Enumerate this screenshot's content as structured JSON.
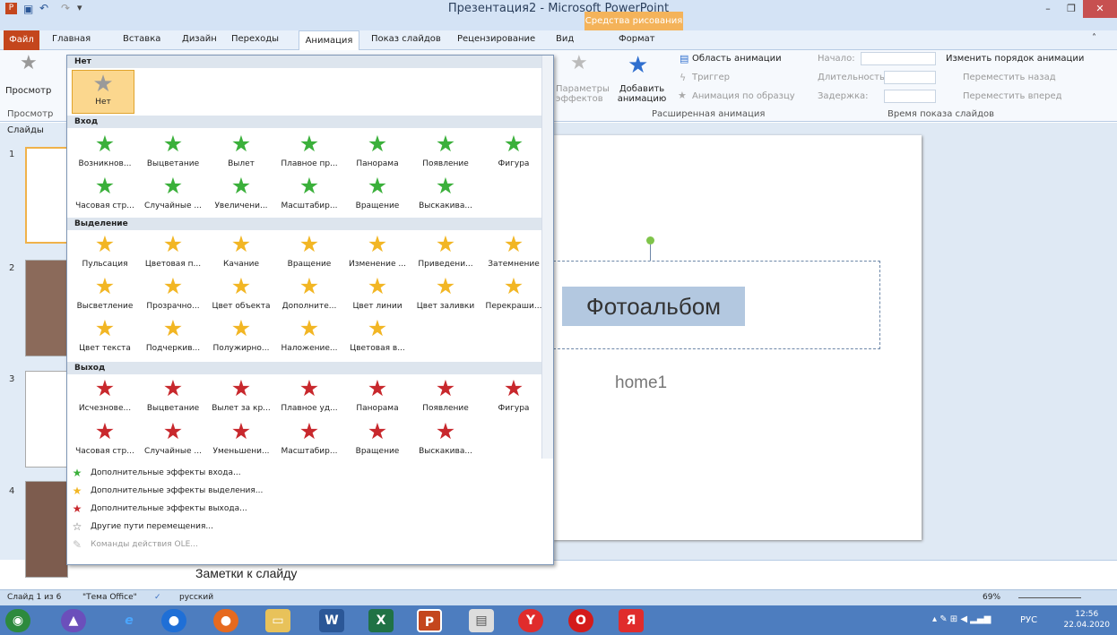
{
  "window": {
    "title": "Презентация2 - Microsoft PowerPoint",
    "contextual_tab_group": "Средства рисования",
    "controls": [
      "–",
      "❐",
      "✕"
    ]
  },
  "tabs": [
    {
      "label": "Файл"
    },
    {
      "label": "Главная"
    },
    {
      "label": "Вставка"
    },
    {
      "label": "Дизайн"
    },
    {
      "label": "Переходы"
    },
    {
      "label": "Анимация"
    },
    {
      "label": "Показ слайдов"
    },
    {
      "label": "Рецензирование"
    },
    {
      "label": "Вид"
    },
    {
      "label": "Формат"
    }
  ],
  "ribbon": {
    "preview": {
      "label": "Просмотр",
      "group": "Просмотр"
    },
    "effect_params": "Параметры эффектов",
    "add_animation": "Добавить анимацию",
    "animation_pane": "Область анимации",
    "trigger": "Триггер",
    "animation_painter": "Анимация по образцу",
    "advanced_group": "Расширенная анимация",
    "start_label": "Начало:",
    "duration_label": "Длительность:",
    "delay_label": "Задержка:",
    "reorder_title": "Изменить порядок анимации",
    "move_back": "Переместить назад",
    "move_forward": "Переместить вперед",
    "timing_group": "Время показа слайдов"
  },
  "slides_panel": {
    "tab": "Слайды",
    "numbers": [
      "1",
      "2",
      "3",
      "4"
    ]
  },
  "gallery": {
    "none": {
      "header": "Нет",
      "item": "Нет"
    },
    "entrance": {
      "header": "Вход",
      "items": [
        "Возникнов...",
        "Выцветание",
        "Вылет",
        "Плавное пр...",
        "Панорама",
        "Появление",
        "Фигура",
        "Часовая стр...",
        "Случайные ...",
        "Увеличени...",
        "Масштабир...",
        "Вращение",
        "Выскакива..."
      ]
    },
    "emphasis": {
      "header": "Выделение",
      "items": [
        "Пульсация",
        "Цветовая п...",
        "Качание",
        "Вращение",
        "Изменение ...",
        "Приведени...",
        "Затемнение",
        "Высветление",
        "Прозрачно...",
        "Цвет объекта",
        "Дополните...",
        "Цвет линии",
        "Цвет заливки",
        "Перекраши...",
        "Цвет текста",
        "Подчеркив...",
        "Полужирно...",
        "Наложение...",
        "Цветовая в..."
      ]
    },
    "exit": {
      "header": "Выход",
      "items": [
        "Исчезнове...",
        "Выцветание",
        "Вылет за кр...",
        "Плавное уд...",
        "Панорама",
        "Появление",
        "Фигура",
        "Часовая стр...",
        "Случайные ...",
        "Уменьшени...",
        "Масштабир...",
        "Вращение",
        "Выскакива..."
      ]
    },
    "more": [
      "Дополнительные эффекты входа...",
      "Дополнительные эффекты выделения...",
      "Дополнительные эффекты выхода...",
      "Другие пути перемещения...",
      "Команды действия OLE..."
    ]
  },
  "slide": {
    "title": "Фотоальбом",
    "subtitle": "home1"
  },
  "notes": {
    "placeholder": "Заметки к слайду"
  },
  "status": {
    "slide": "Слайд 1 из 6",
    "theme": "\"Тема Office\"",
    "language": "русский",
    "zoom": "69%"
  },
  "taskbar": {
    "lang": "РУС",
    "time": "12:56",
    "date": "22.04.2020"
  },
  "colors": {
    "accent": "#c4461d",
    "entrance": "#3bb03b",
    "emphasis": "#f2b624",
    "exit": "#c8282d",
    "selection": "#fbd78e"
  }
}
